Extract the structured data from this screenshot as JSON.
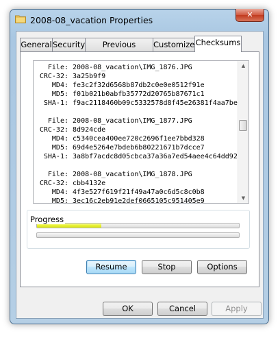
{
  "window": {
    "title": "2008-08_vacation Properties",
    "close_glyph": "✕"
  },
  "tabs": [
    {
      "label": "General"
    },
    {
      "label": "Security"
    },
    {
      "label": "Previous Versions"
    },
    {
      "label": "Customize"
    },
    {
      "label": "Checksums"
    }
  ],
  "active_tab": "Checksums",
  "checksums": {
    "lines": [
      {
        "label": "File:",
        "value": "2008-08_vacation\\IMG_1876.JPG"
      },
      {
        "label": "CRC-32:",
        "value": "3a25b9f9"
      },
      {
        "label": "MD4:",
        "value": "fe3c2f32d6568b87db2c0e0e0512f91e"
      },
      {
        "label": "MD5:",
        "value": "f01b021b0abfb35772d20765b87671c1"
      },
      {
        "label": "SHA-1:",
        "value": "f9ac2118460b09c5332578d8f45e26381f4aa7be"
      },
      {
        "label": "",
        "value": ""
      },
      {
        "label": "File:",
        "value": "2008-08_vacation\\IMG_1877.JPG"
      },
      {
        "label": "CRC-32:",
        "value": "8d924cde"
      },
      {
        "label": "MD4:",
        "value": "c5340cea400ee720c2696f1ee7bbd328"
      },
      {
        "label": "MD5:",
        "value": "69d4e5264e7bdeb6b80221671b7dcce7"
      },
      {
        "label": "SHA-1:",
        "value": "3a8bf7acdc8d05cbca37a36a7ed54aee4c64dd92"
      },
      {
        "label": "",
        "value": ""
      },
      {
        "label": "File:",
        "value": "2008-08_vacation\\IMG_1878.JPG"
      },
      {
        "label": "CRC-32:",
        "value": "cbb4132e"
      },
      {
        "label": "MD4:",
        "value": "4f3e527f619f21f49a47a0c6d5c8c0b8"
      },
      {
        "label": "MD5:",
        "value": "3ec16c2eb91e2def0665105c951405e9"
      }
    ]
  },
  "progress": {
    "label": "Progress",
    "bar1_fraction": 0.32,
    "bar2_fraction": 0.0,
    "bar_color": "#e7ef2e"
  },
  "buttons": {
    "resume": "Resume",
    "stop": "Stop",
    "options": "Options",
    "ok": "OK",
    "cancel": "Cancel",
    "apply": "Apply"
  },
  "icons": {
    "title": "folder-icon",
    "close": "close-icon",
    "scroll_up": "scroll-up-arrow-icon",
    "scroll_down": "scroll-down-arrow-icon"
  },
  "colors": {
    "title_gradient": "#b8d3ea",
    "close_red": "#c13b1f",
    "default_button_border": "#3c7fb1"
  }
}
